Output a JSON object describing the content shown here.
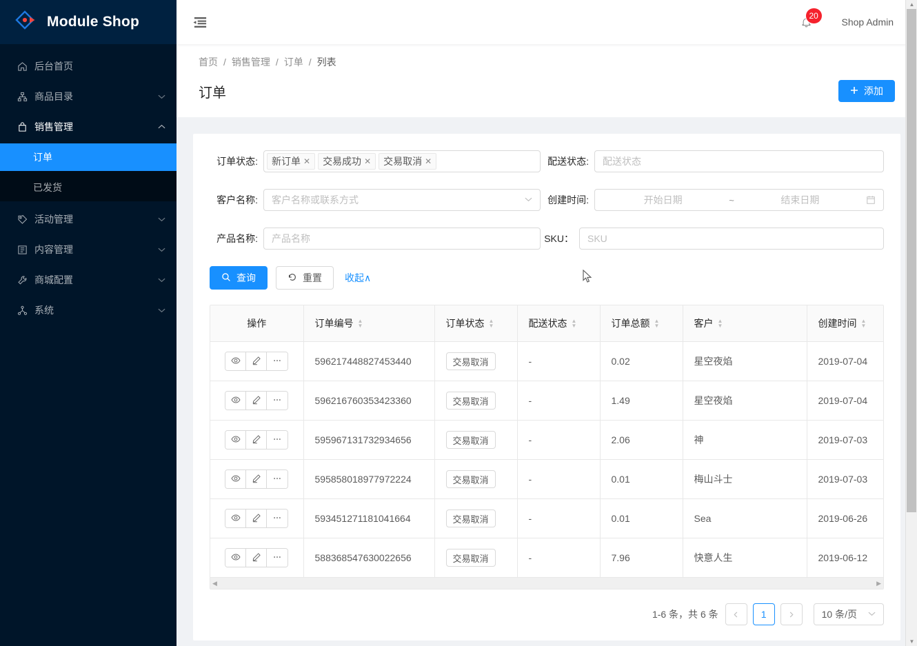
{
  "brand": {
    "title": "Module Shop",
    "accent": "#1890ff",
    "danger": "#f5222d",
    "sidebar_bg": "#001529"
  },
  "sidebar": {
    "items": [
      {
        "label": "后台首页",
        "icon": "home-icon",
        "arrow": ""
      },
      {
        "label": "商品目录",
        "icon": "product-catalog-icon",
        "arrow": "chevron-down"
      },
      {
        "label": "销售管理",
        "icon": "shopping-bag-icon",
        "arrow": "chevron-up",
        "open": true
      },
      {
        "label": "活动管理",
        "icon": "tag-icon",
        "arrow": "chevron-down"
      },
      {
        "label": "内容管理",
        "icon": "content-icon",
        "arrow": "chevron-down"
      },
      {
        "label": "商城配置",
        "icon": "wrench-icon",
        "arrow": "chevron-down"
      },
      {
        "label": "系统",
        "icon": "system-icon",
        "arrow": "chevron-down"
      }
    ],
    "submenu": [
      {
        "label": "订单",
        "active": true
      },
      {
        "label": "已发货",
        "active": false
      }
    ]
  },
  "topbar": {
    "fold_icon": "menu-fold-icon",
    "bell_icon": "bell-icon",
    "notification_count": "20",
    "user": "Shop Admin"
  },
  "breadcrumb": {
    "items": [
      "首页",
      "销售管理",
      "订单",
      "列表"
    ],
    "separator": "/"
  },
  "page": {
    "title": "订单",
    "add_button": "添加",
    "add_icon": "plus-icon"
  },
  "filters": {
    "order_status": {
      "label": "订单状态:",
      "tags": [
        "新订单",
        "交易成功",
        "交易取消"
      ],
      "remove_icon": "close-icon"
    },
    "delivery_status": {
      "label": "配送状态:",
      "placeholder": "配送状态",
      "value": ""
    },
    "customer_name": {
      "label": "客户名称:",
      "placeholder": "客户名称或联系方式",
      "value": "",
      "caret_icon": "chevron-down-icon"
    },
    "created_time": {
      "label": "创建时间:",
      "start_placeholder": "开始日期",
      "end_placeholder": "结束日期",
      "separator": "~",
      "calendar_icon": "calendar-icon"
    },
    "product_name": {
      "label": "产品名称:",
      "placeholder": "产品名称",
      "value": ""
    },
    "sku": {
      "label": "SKU：",
      "placeholder": "SKU",
      "value": ""
    },
    "actions": {
      "search": "查询",
      "search_icon": "search-icon",
      "reset": "重置",
      "reset_icon": "reload-icon",
      "collapse": "收起∧"
    }
  },
  "table": {
    "columns": [
      {
        "key": "action",
        "label": "操作",
        "sortable": false
      },
      {
        "key": "order_no",
        "label": "订单编号",
        "sortable": true
      },
      {
        "key": "order_status",
        "label": "订单状态",
        "sortable": true
      },
      {
        "key": "delivery_status",
        "label": "配送状态",
        "sortable": true
      },
      {
        "key": "total",
        "label": "订单总额",
        "sortable": true
      },
      {
        "key": "customer",
        "label": "客户",
        "sortable": true
      },
      {
        "key": "created",
        "label": "创建时间",
        "sortable": true
      }
    ],
    "row_action_icons": [
      "eye-icon",
      "pencil-icon",
      "ellipsis-icon"
    ],
    "rows": [
      {
        "order_no": "596217448827453440",
        "order_status": "交易取消",
        "delivery_status": "-",
        "total": "0.02",
        "customer": "星空夜焰",
        "created": "2019-07-04"
      },
      {
        "order_no": "596216760353423360",
        "order_status": "交易取消",
        "delivery_status": "-",
        "total": "1.49",
        "customer": "星空夜焰",
        "created": "2019-07-04"
      },
      {
        "order_no": "595967131732934656",
        "order_status": "交易取消",
        "delivery_status": "-",
        "total": "2.06",
        "customer": "神",
        "created": "2019-07-03"
      },
      {
        "order_no": "595858018977972224",
        "order_status": "交易取消",
        "delivery_status": "-",
        "total": "0.01",
        "customer": "梅山斗士",
        "created": "2019-07-03"
      },
      {
        "order_no": "593451271181041664",
        "order_status": "交易取消",
        "delivery_status": "-",
        "total": "0.01",
        "customer": "Sea",
        "created": "2019-06-26"
      },
      {
        "order_no": "588368547630022656",
        "order_status": "交易取消",
        "delivery_status": "-",
        "total": "7.96",
        "customer": "快意人生",
        "created": "2019-06-12"
      }
    ]
  },
  "pagination": {
    "total_text": "1-6 条，共 6 条",
    "prev_icon": "chevron-left-icon",
    "next_icon": "chevron-right-icon",
    "pages": [
      "1"
    ],
    "current": "1",
    "page_size": "10 条/页",
    "page_size_caret": "chevron-down-icon"
  }
}
